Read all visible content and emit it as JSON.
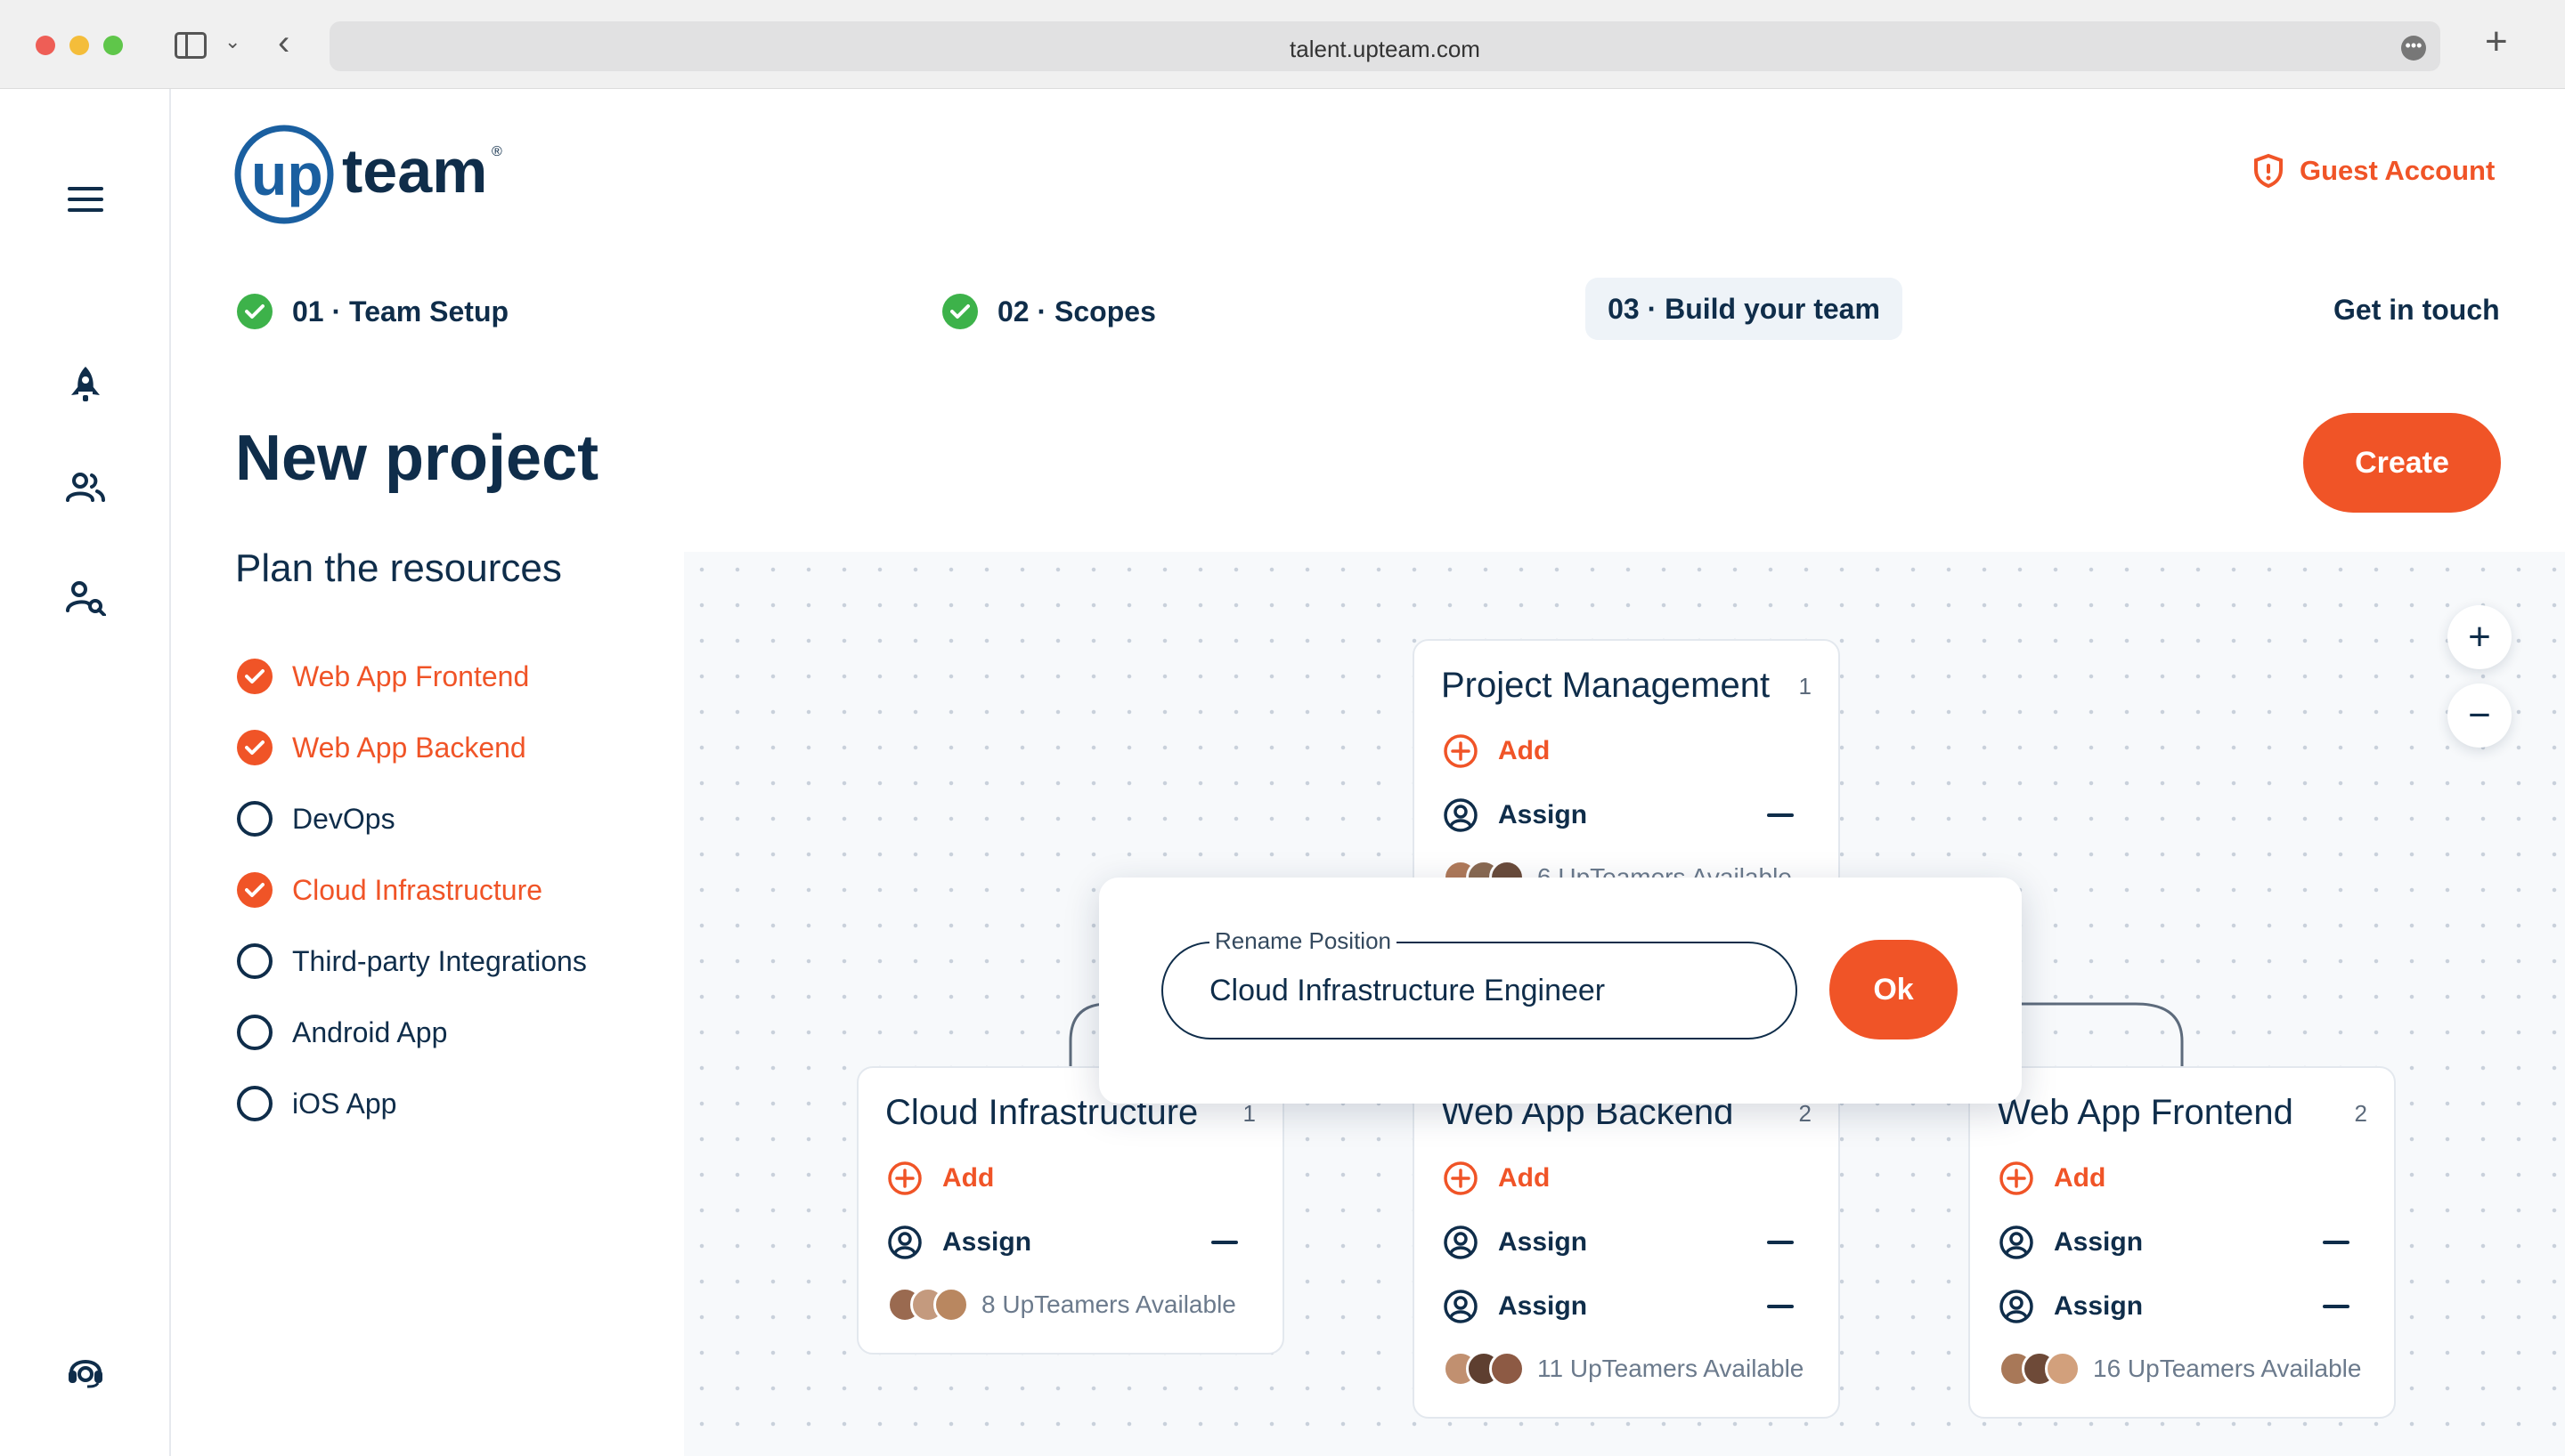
{
  "browser": {
    "url": "talent.upteam.com"
  },
  "logo": {
    "text_up": "up",
    "text_team": "team",
    "mark": "®"
  },
  "header": {
    "guest_account": "Guest Account",
    "get_in_touch": "Get in touch"
  },
  "steps": [
    {
      "label": "01 · Team Setup",
      "done": true
    },
    {
      "label": "02 · Scopes",
      "done": true
    },
    {
      "label": "03 · Build your team",
      "active": true
    }
  ],
  "page": {
    "title": "New project",
    "create_label": "Create",
    "plan_title": "Plan the resources"
  },
  "resources": [
    {
      "label": "Web App Frontend",
      "checked": true
    },
    {
      "label": "Web App Backend",
      "checked": true
    },
    {
      "label": "DevOps",
      "checked": false
    },
    {
      "label": "Cloud Infrastructure",
      "checked": true
    },
    {
      "label": "Third-party Integrations",
      "checked": false
    },
    {
      "label": "Android App",
      "checked": false
    },
    {
      "label": "iOS App",
      "checked": false
    }
  ],
  "zoom": {
    "in": "+",
    "out": "−"
  },
  "cards": {
    "pm": {
      "title": "Project Management",
      "count": "1",
      "add": "Add",
      "assign": "Assign",
      "available": "6 UpTeamers Available"
    },
    "cloud": {
      "title": "Cloud Infrastructure",
      "count": "1",
      "add": "Add",
      "assign": "Assign",
      "available": "8 UpTeamers Available"
    },
    "backend": {
      "title": "Web App Backend",
      "count": "2",
      "add": "Add",
      "assign": "Assign",
      "available": "11 UpTeamers Available"
    },
    "frontend": {
      "title": "Web App Frontend",
      "count": "2",
      "add": "Add",
      "assign": "Assign",
      "available": "16 UpTeamers Available"
    }
  },
  "modal": {
    "label": "Rename Position",
    "value": "Cloud Infrastructure Engineer",
    "ok": "Ok"
  },
  "colors": {
    "accent": "#f05427",
    "navy": "#0f2d4a",
    "success": "#3db24a"
  },
  "icons": [
    "menu-icon",
    "rocket-icon",
    "team-icon",
    "user-search-icon",
    "support-icon",
    "shield-icon",
    "check-icon",
    "add-circle-icon",
    "user-circle-icon",
    "minus-icon"
  ]
}
